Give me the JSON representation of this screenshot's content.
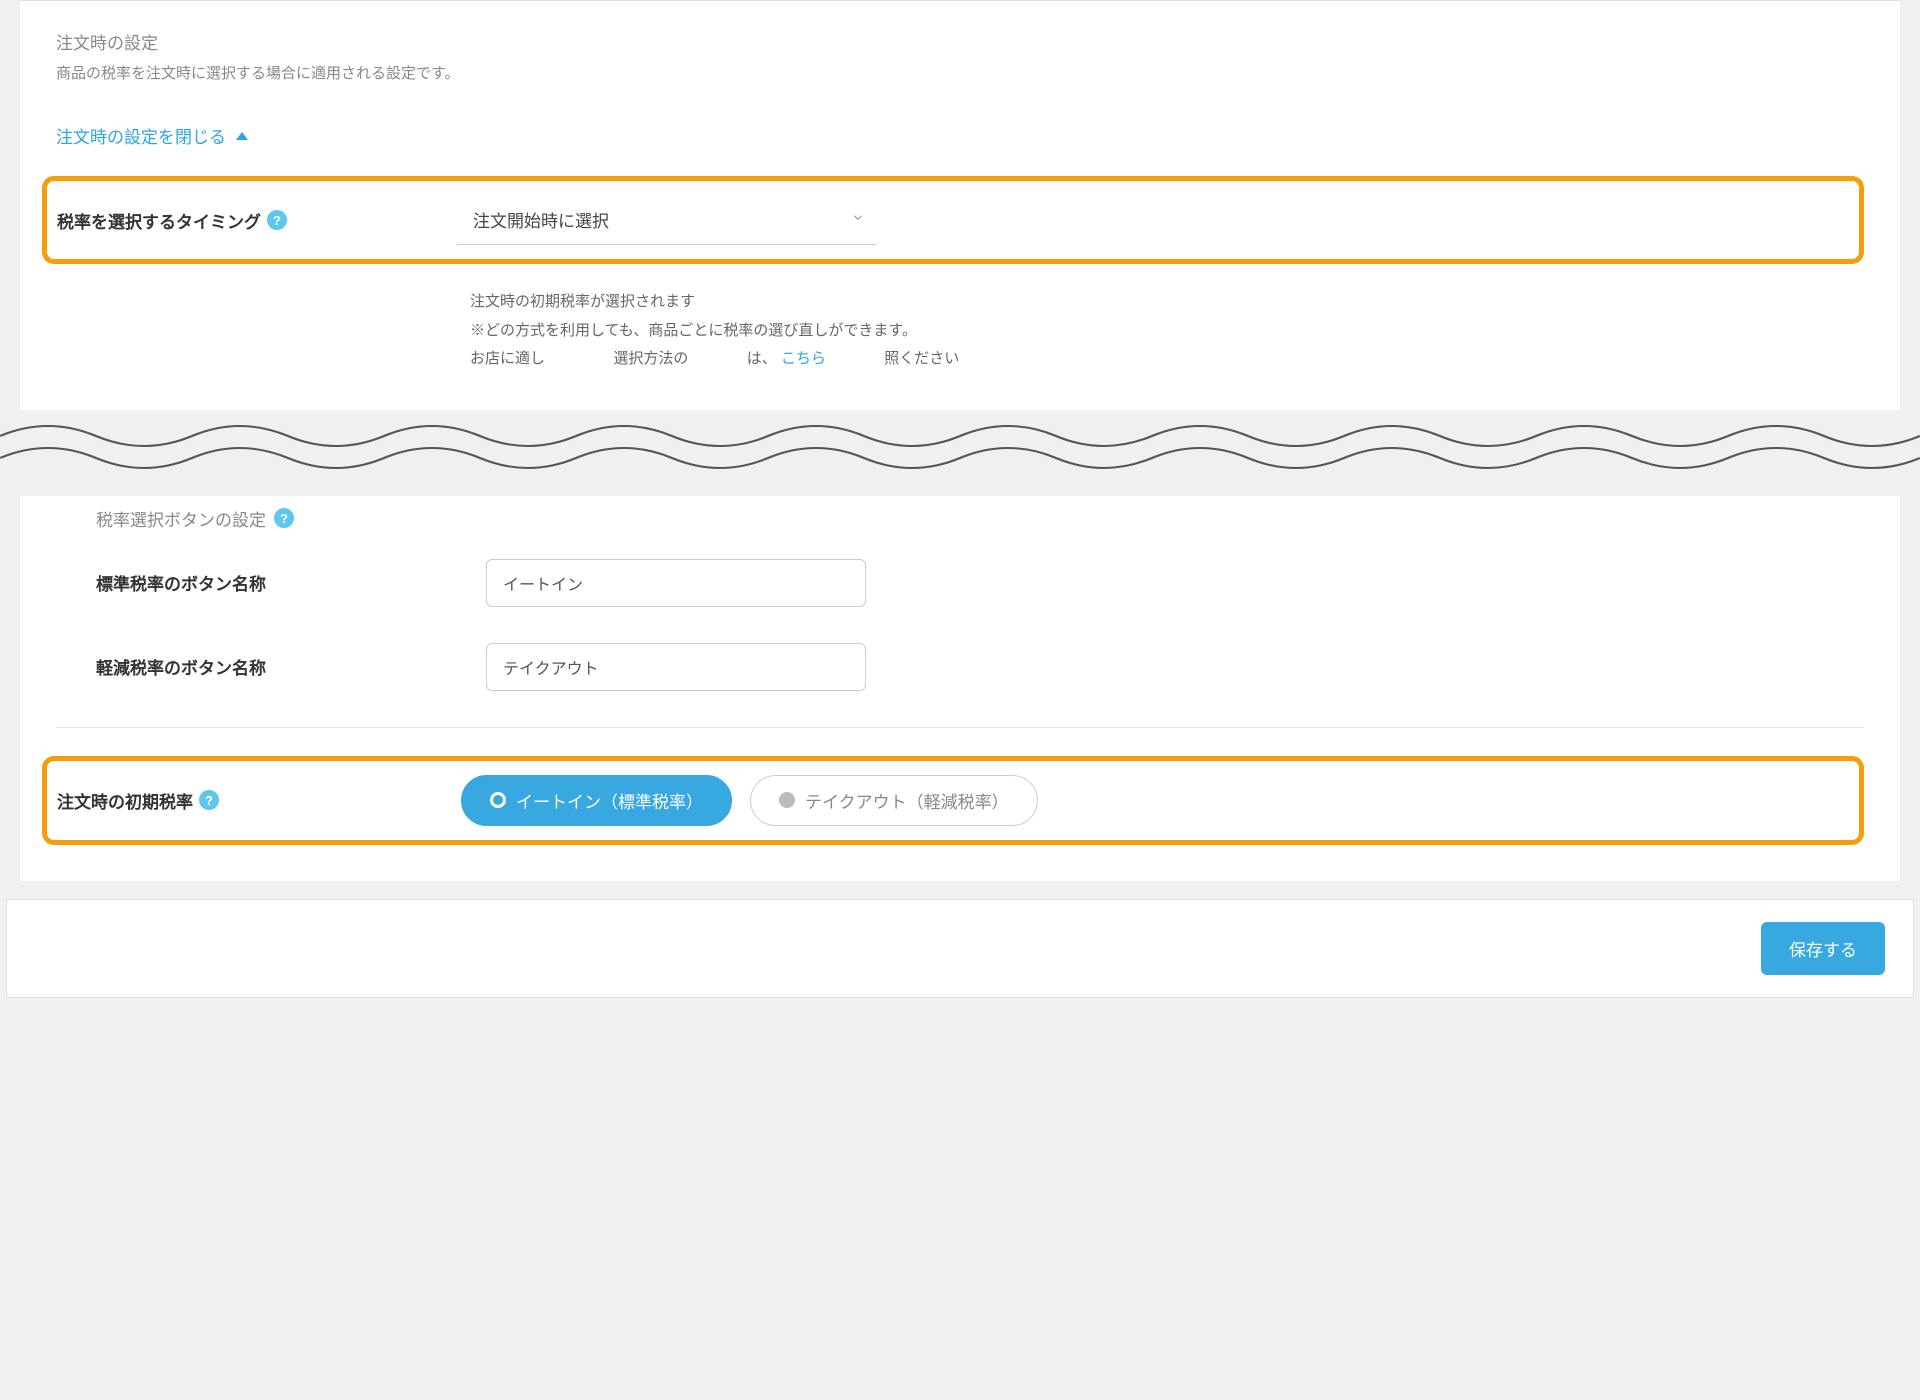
{
  "header": {
    "section_title": "注文時の設定",
    "section_desc": "商品の税率を注文時に選択する場合に適用される設定です。",
    "collapse_label": "注文時の設定を閉じる"
  },
  "timing": {
    "label": "税率を選択するタイミング",
    "selected": "注文開始時に選択",
    "helper_line1": "注文時の初期税率が選択されます",
    "helper_line2_pre": "※どの方式を利用しても、商品ごとに税率の選び直しができます。",
    "helper_line3_pre": "お店に適し",
    "helper_line3_mid": "選択方法の",
    "helper_line3_post": "は、",
    "helper_link": "こちら",
    "helper_line3_end": "照ください"
  },
  "button_settings": {
    "section_label": "税率選択ボタンの設定",
    "standard_label": "標準税率のボタン名称",
    "standard_value": "イートイン",
    "reduced_label": "軽減税率のボタン名称",
    "reduced_value": "テイクアウト"
  },
  "default_rate": {
    "label": "注文時の初期税率",
    "option_selected": "イートイン（標準税率）",
    "option_unselected": "テイクアウト（軽減税率）"
  },
  "footer": {
    "save_label": "保存する"
  }
}
